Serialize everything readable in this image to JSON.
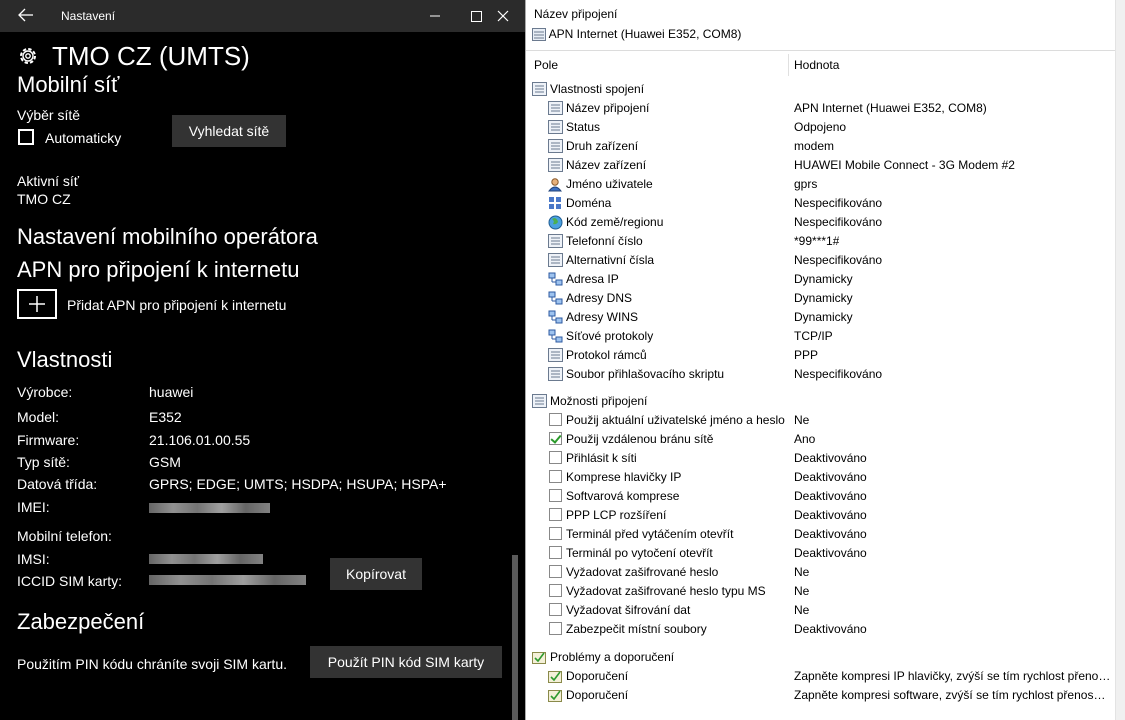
{
  "window": {
    "title": "Nastavení"
  },
  "settings": {
    "page_title": "TMO CZ (UMTS)",
    "mobile_network": {
      "heading": "Mobilní síť",
      "network_selection_label": "Výběr sítě",
      "automatic_label": "Automaticky",
      "automatic_checked": false,
      "search_button": "Vyhledat sítě",
      "active_network_label": "Aktivní síť",
      "active_network_value": "TMO CZ"
    },
    "operator_heading": "Nastavení mobilního operátora",
    "apn_heading": "APN pro připojení k internetu",
    "add_apn_label": "Přidat APN pro připojení k internetu",
    "properties": {
      "heading": "Vlastnosti",
      "items": [
        {
          "label": "Výrobce:",
          "value": "huawei"
        },
        {
          "label": "Model:",
          "value": "E352"
        },
        {
          "label": "Firmware:",
          "value": "21.106.01.00.55"
        },
        {
          "label": "Typ sítě:",
          "value": "GSM"
        },
        {
          "label": "Datová třída:",
          "value": "GPRS; EDGE; UMTS; HSDPA; HSUPA; HSPA+"
        },
        {
          "label": "IMEI:",
          "value": ""
        }
      ],
      "mobile_phone_label": "Mobilní telefon:",
      "imsi_label": "IMSI:",
      "iccid_label": "ICCID SIM karty:",
      "copy_button": "Kopírovat"
    },
    "security": {
      "heading": "Zabezpečení",
      "description": "Použitím PIN kódu chráníte svoji SIM kartu.",
      "pin_button": "Použít PIN kód SIM karty"
    }
  },
  "connection": {
    "name_label": "Název připojení",
    "name_value": "APN Internet (Huawei E352, COM8)",
    "columns": {
      "field": "Pole",
      "value": "Hodnota"
    },
    "groups": [
      {
        "title": "Vlastnosti spojení",
        "rows": [
          {
            "icon": "prop-icon",
            "label": "Název připojení",
            "value": "APN Internet (Huawei E352, COM8)"
          },
          {
            "icon": "prop-icon",
            "label": "Status",
            "value": "Odpojeno"
          },
          {
            "icon": "prop-icon",
            "label": "Druh zařízení",
            "value": "modem"
          },
          {
            "icon": "prop-icon",
            "label": "Název zařízení",
            "value": "HUAWEI Mobile Connect - 3G Modem #2"
          },
          {
            "icon": "user-icon",
            "label": "Jméno uživatele",
            "value": "gprs"
          },
          {
            "icon": "domain-icon",
            "label": "Doména",
            "value": "Nespecifikováno"
          },
          {
            "icon": "globe-icon",
            "label": "Kód země/regionu",
            "value": "Nespecifikováno"
          },
          {
            "icon": "prop-icon",
            "label": "Telefonní číslo",
            "value": "*99***1#"
          },
          {
            "icon": "prop-icon",
            "label": "Alternativní čísla",
            "value": "Nespecifikováno"
          },
          {
            "icon": "network-icon",
            "label": "Adresa IP",
            "value": "Dynamicky"
          },
          {
            "icon": "network-icon",
            "label": "Adresy DNS",
            "value": "Dynamicky"
          },
          {
            "icon": "network-icon",
            "label": "Adresy WINS",
            "value": "Dynamicky"
          },
          {
            "icon": "network-icon",
            "label": "Síťové protokoly",
            "value": "TCP/IP"
          },
          {
            "icon": "prop-icon",
            "label": "Protokol rámců",
            "value": "PPP"
          },
          {
            "icon": "prop-icon",
            "label": "Soubor přihlašovacího skriptu",
            "value": "Nespecifikováno"
          }
        ]
      },
      {
        "title": "Možnosti připojení",
        "rows": [
          {
            "checked": false,
            "label": "Použij aktuální uživatelské jméno a heslo",
            "value": "Ne"
          },
          {
            "checked": true,
            "label": "Použij vzdálenou bránu sítě",
            "value": "Ano"
          },
          {
            "checked": false,
            "label": "Přihlásit k síti",
            "value": "Deaktivováno"
          },
          {
            "checked": false,
            "label": "Komprese hlavičky IP",
            "value": "Deaktivováno"
          },
          {
            "checked": false,
            "label": "Softvarová komprese",
            "value": "Deaktivováno"
          },
          {
            "checked": false,
            "label": "PPP LCP rozšíření",
            "value": "Deaktivováno"
          },
          {
            "checked": false,
            "label": "Terminál před vytáčením otevřít",
            "value": "Deaktivováno"
          },
          {
            "checked": false,
            "label": "Terminál po vytočení otevřít",
            "value": "Deaktivováno"
          },
          {
            "checked": false,
            "label": "Vyžadovat zašifrované heslo",
            "value": "Ne"
          },
          {
            "checked": false,
            "label": "Vyžadovat zašifrované heslo typu MS",
            "value": "Ne"
          },
          {
            "checked": false,
            "label": "Vyžadovat šifrování dat",
            "value": "Ne"
          },
          {
            "checked": false,
            "label": "Zabezpečit místní soubory",
            "value": "Deaktivováno"
          }
        ]
      },
      {
        "title": "Problémy a doporučení",
        "rows": [
          {
            "icon": "recommend-icon",
            "label": "Doporučení",
            "value": "Zapněte kompresi IP hlavičky, zvýší se tím rychlost přenos..."
          },
          {
            "icon": "recommend-icon",
            "label": "Doporučení",
            "value": "Zapněte kompresi software, zvýší se tím rychlost přenosu ..."
          }
        ]
      }
    ]
  }
}
